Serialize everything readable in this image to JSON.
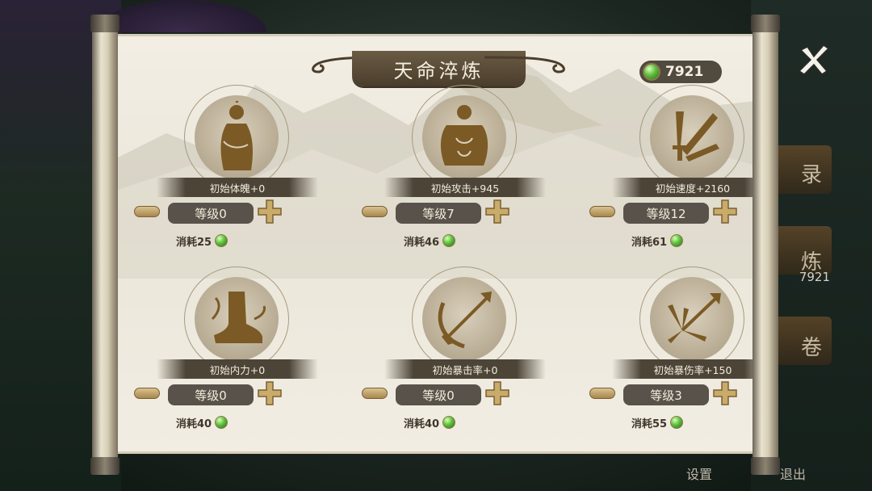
{
  "panel": {
    "title": "天命淬炼",
    "currency_amount": "7921"
  },
  "background": {
    "right_currency": "7921",
    "right_chars": [
      "录",
      "炼",
      "卷"
    ],
    "bottom_left": "设置",
    "bottom_right": "退出"
  },
  "stats": [
    {
      "label": "初始体魄+0",
      "level": "等级0",
      "cost": "消耗25",
      "icon": "body-silhouette-icon"
    },
    {
      "label": "初始攻击+945",
      "level": "等级7",
      "cost": "消耗46",
      "icon": "muscle-torso-icon"
    },
    {
      "label": "初始速度+2160",
      "level": "等级12",
      "cost": "消耗61",
      "icon": "crossed-swords-icon"
    },
    {
      "label": "初始内力+0",
      "level": "等级0",
      "cost": "消耗40",
      "icon": "boot-icon"
    },
    {
      "label": "初始暴击率+0",
      "level": "等级0",
      "cost": "消耗40",
      "icon": "bow-arrow-icon"
    },
    {
      "label": "初始暴伤率+150",
      "level": "等级3",
      "cost": "消耗55",
      "icon": "arrows-burst-icon"
    }
  ],
  "colors": {
    "paper": "#efeadf",
    "banner": "#4a3d2b",
    "label_bg": "#4c4437",
    "icon_fill": "#7b5a25",
    "button_gold": "#c9ab6a",
    "gem_green": "#5fbf3c"
  }
}
